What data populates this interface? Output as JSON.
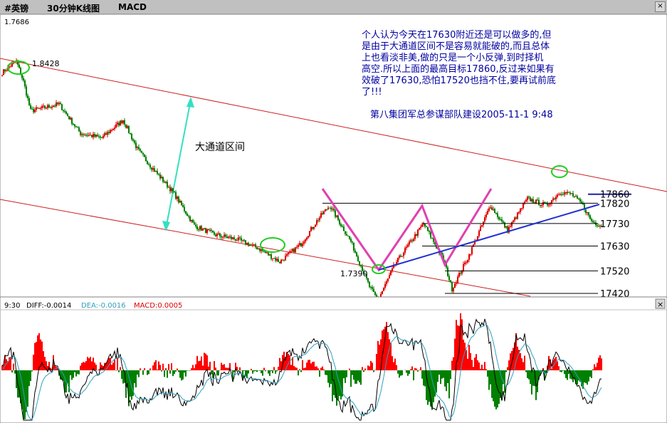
{
  "window": {
    "symbol": "#英镑",
    "period": "30分钟K线图",
    "indicator": "MACD",
    "close_glyph": "×"
  },
  "chart_data": [
    {
      "type": "candlestick",
      "title": "",
      "top_left_label": "1.7686",
      "high_label": "1.8428",
      "low_label": "1.7390",
      "channel_label": "大通道区间",
      "levels": [
        {
          "label": "17860",
          "value": 1.786
        },
        {
          "label": "17820",
          "value": 1.782
        },
        {
          "label": "17730",
          "value": 1.773
        },
        {
          "label": "17630",
          "value": 1.763
        },
        {
          "label": "17520",
          "value": 1.752
        },
        {
          "label": "17420",
          "value": 1.742
        }
      ],
      "approx_price_path": [
        {
          "bar": 0,
          "price": 1.84
        },
        {
          "bar": 10,
          "price": 1.845
        },
        {
          "bar": 15,
          "price": 1.836
        },
        {
          "bar": 20,
          "price": 1.823
        },
        {
          "bar": 40,
          "price": 1.826
        },
        {
          "bar": 55,
          "price": 1.813
        },
        {
          "bar": 70,
          "price": 1.811
        },
        {
          "bar": 85,
          "price": 1.819
        },
        {
          "bar": 95,
          "price": 1.806
        },
        {
          "bar": 105,
          "price": 1.798
        },
        {
          "bar": 120,
          "price": 1.787
        },
        {
          "bar": 135,
          "price": 1.772
        },
        {
          "bar": 150,
          "price": 1.768
        },
        {
          "bar": 165,
          "price": 1.766
        },
        {
          "bar": 180,
          "price": 1.762
        },
        {
          "bar": 195,
          "price": 1.756
        },
        {
          "bar": 210,
          "price": 1.764
        },
        {
          "bar": 222,
          "price": 1.775
        },
        {
          "bar": 230,
          "price": 1.781
        },
        {
          "bar": 245,
          "price": 1.765
        },
        {
          "bar": 258,
          "price": 1.745
        },
        {
          "bar": 264,
          "price": 1.739
        },
        {
          "bar": 276,
          "price": 1.755
        },
        {
          "bar": 296,
          "price": 1.773
        },
        {
          "bar": 310,
          "price": 1.757
        },
        {
          "bar": 316,
          "price": 1.744
        },
        {
          "bar": 328,
          "price": 1.759
        },
        {
          "bar": 343,
          "price": 1.781
        },
        {
          "bar": 355,
          "price": 1.77
        },
        {
          "bar": 369,
          "price": 1.784
        },
        {
          "bar": 382,
          "price": 1.781
        },
        {
          "bar": 392,
          "price": 1.787
        },
        {
          "bar": 400,
          "price": 1.786
        },
        {
          "bar": 408,
          "price": 1.781
        },
        {
          "bar": 414,
          "price": 1.774
        },
        {
          "bar": 421,
          "price": 1.772
        }
      ],
      "annotations": [
        "个人认为今天在17630附近还是可以做多的,但",
        "是由于大通道区间不是容易就能破的,而且总体",
        "上也看淡非美,做的只是一个小反弹,到时择机",
        "高空.所以上面的最高目标17860,反过来如果有",
        "效破了17630,恐怕17520也挡不住,要再试前底",
        "了!!!"
      ],
      "signature": "第八集团军总参谋部队建设2005-11-1  9:48"
    },
    {
      "type": "bar",
      "indicator": "MACD",
      "time_label": "9:30",
      "series": [
        {
          "name": "DIFF",
          "last_value": "-0.0014",
          "color": "#000000"
        },
        {
          "name": "DEA",
          "last_value": "-0.0016",
          "color": "#2f9fbf"
        },
        {
          "name": "MACD",
          "last_value": "0.0005",
          "color": "#e00000"
        }
      ],
      "labels": {
        "time": "9:30",
        "diff": "DIFF:-0.0014",
        "dea": "DEA:-0.0016",
        "macd": "MACD:0.0005"
      },
      "positive_color": "#ff0000",
      "negative_color": "#008000",
      "zero_axis": 0
    }
  ]
}
